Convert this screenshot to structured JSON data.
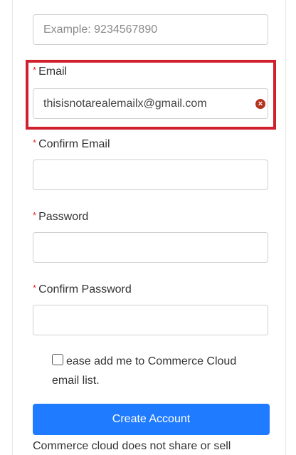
{
  "form": {
    "phone": {
      "placeholder": "Example: 9234567890",
      "value": ""
    },
    "email": {
      "required_marker": "*",
      "label": "Email",
      "value": "thisisnotarealemailx@gmail.com",
      "error_icon": "error-circle-x-icon",
      "error_icon_glyph": "×"
    },
    "confirm_email": {
      "required_marker": "*",
      "label": "Confirm Email",
      "value": ""
    },
    "password": {
      "required_marker": "*",
      "label": "Password",
      "value": ""
    },
    "confirm_password": {
      "required_marker": "*",
      "label": "Confirm Password",
      "value": ""
    },
    "mailing_list": {
      "label": "ease add me to Commerce Cloud email list.",
      "checked": false
    },
    "submit_label": "Create Account",
    "footer_note": "Commerce cloud does not share or sell"
  },
  "colors": {
    "required": "#e03131",
    "highlight": "#d0202e",
    "primary_button": "#1f7bff",
    "error_icon": "#b5321e"
  }
}
